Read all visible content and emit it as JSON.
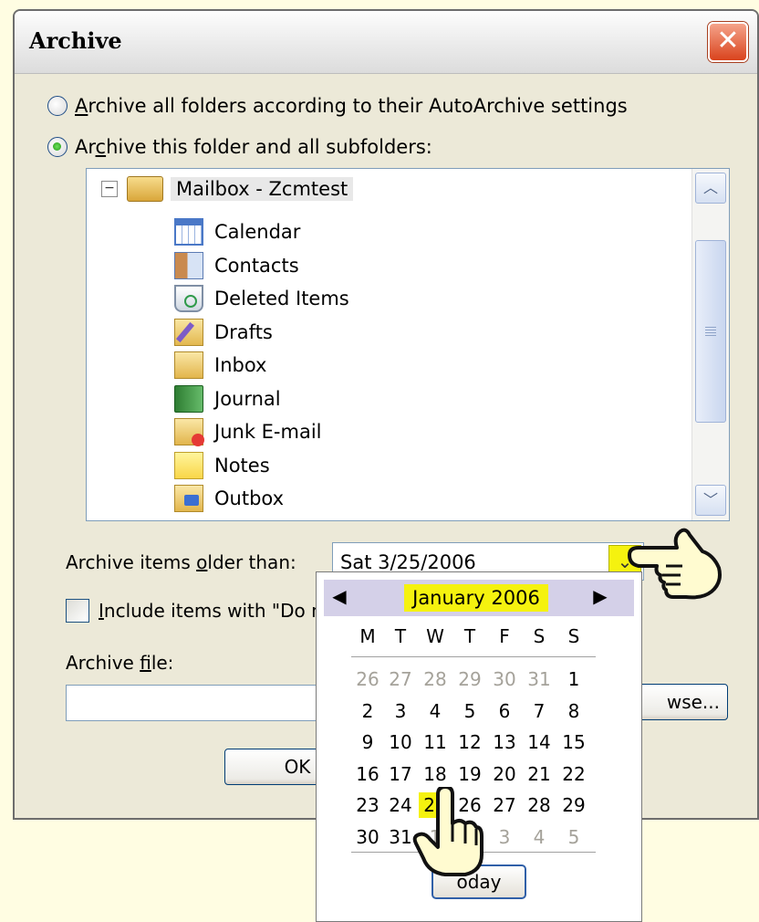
{
  "window": {
    "title": "Archive"
  },
  "options": {
    "all_folders": {
      "prefix": "A",
      "rest": "rchive all folders according to their AutoArchive settings",
      "checked": false
    },
    "this_folder": {
      "prefix": "Ar",
      "ul": "c",
      "rest": "hive this folder and all subfolders:",
      "checked": true
    }
  },
  "tree": {
    "root": "Mailbox - Zcmtest",
    "items": [
      {
        "label": "Calendar",
        "icon": "calendar-icon"
      },
      {
        "label": "Contacts",
        "icon": "contacts-icon"
      },
      {
        "label": "Deleted Items",
        "icon": "deleted-items-icon"
      },
      {
        "label": "Drafts",
        "icon": "drafts-icon"
      },
      {
        "label": "Inbox",
        "icon": "inbox-icon"
      },
      {
        "label": "Journal",
        "icon": "journal-icon"
      },
      {
        "label": "Junk E-mail",
        "icon": "junk-email-icon"
      },
      {
        "label": "Notes",
        "icon": "notes-icon"
      },
      {
        "label": "Outbox",
        "icon": "outbox-icon"
      }
    ]
  },
  "older_than": {
    "label_pre": "Archive items ",
    "label_ul": "o",
    "label_post": "lder than:",
    "value": "Sat 3/25/2006"
  },
  "include": {
    "pre": "",
    "ul": "I",
    "post": "nclude items with \"Do n"
  },
  "archive_file": {
    "pre": "Archive ",
    "ul": "f",
    "post": "ile:",
    "value": "",
    "browse": "wse..."
  },
  "buttons": {
    "ok": "OK",
    "today": "oday"
  },
  "calendar": {
    "month": "January 2006",
    "days_of_week": [
      "M",
      "T",
      "W",
      "T",
      "F",
      "S",
      "S"
    ],
    "weeks": [
      [
        {
          "d": "26",
          "o": true
        },
        {
          "d": "27",
          "o": true
        },
        {
          "d": "28",
          "o": true
        },
        {
          "d": "29",
          "o": true
        },
        {
          "d": "30",
          "o": true
        },
        {
          "d": "31",
          "o": true
        },
        {
          "d": "1",
          "o": false
        }
      ],
      [
        {
          "d": "2",
          "o": false
        },
        {
          "d": "3",
          "o": false
        },
        {
          "d": "4",
          "o": false
        },
        {
          "d": "5",
          "o": false
        },
        {
          "d": "6",
          "o": false
        },
        {
          "d": "7",
          "o": false
        },
        {
          "d": "8",
          "o": false
        }
      ],
      [
        {
          "d": "9",
          "o": false
        },
        {
          "d": "10",
          "o": false
        },
        {
          "d": "11",
          "o": false
        },
        {
          "d": "12",
          "o": false
        },
        {
          "d": "13",
          "o": false
        },
        {
          "d": "14",
          "o": false
        },
        {
          "d": "15",
          "o": false
        }
      ],
      [
        {
          "d": "16",
          "o": false
        },
        {
          "d": "17",
          "o": false
        },
        {
          "d": "18",
          "o": false
        },
        {
          "d": "19",
          "o": false
        },
        {
          "d": "20",
          "o": false
        },
        {
          "d": "21",
          "o": false
        },
        {
          "d": "22",
          "o": false
        }
      ],
      [
        {
          "d": "23",
          "o": false
        },
        {
          "d": "24",
          "o": false
        },
        {
          "d": "25",
          "o": false,
          "sel": true
        },
        {
          "d": "26",
          "o": false
        },
        {
          "d": "27",
          "o": false
        },
        {
          "d": "28",
          "o": false
        },
        {
          "d": "29",
          "o": false
        }
      ],
      [
        {
          "d": "30",
          "o": false
        },
        {
          "d": "31",
          "o": false
        },
        {
          "d": "1",
          "o": true
        },
        {
          "d": "2",
          "o": true
        },
        {
          "d": "3",
          "o": true
        },
        {
          "d": "4",
          "o": true
        },
        {
          "d": "5",
          "o": true
        }
      ]
    ],
    "highlight_color": "#f5f20f"
  },
  "colors": {
    "background": "#fffde2",
    "dialog": "#ece9d8",
    "close_button": "#d9431d"
  }
}
